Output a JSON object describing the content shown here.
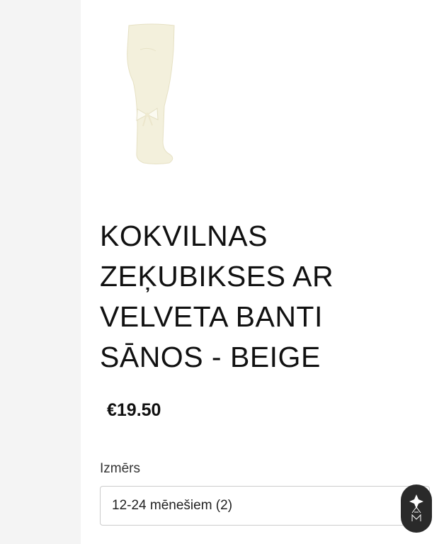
{
  "product": {
    "title": "KOKVILNAS ZEĶUBIKSES AR VELVETA BANTI SĀNOS - BEIGE",
    "price": "€19.50",
    "image_icon": "beige-tights-with-bow"
  },
  "size": {
    "label": "Izmērs",
    "selected": "12-24 mēnešiem (2)"
  },
  "brand_badge": {
    "icon": "brand-logo-icon"
  },
  "colors": {
    "rail": "#f4f4f4",
    "text": "#111111",
    "badge": "#2a2a2a",
    "tights": "#f3f0dc"
  }
}
